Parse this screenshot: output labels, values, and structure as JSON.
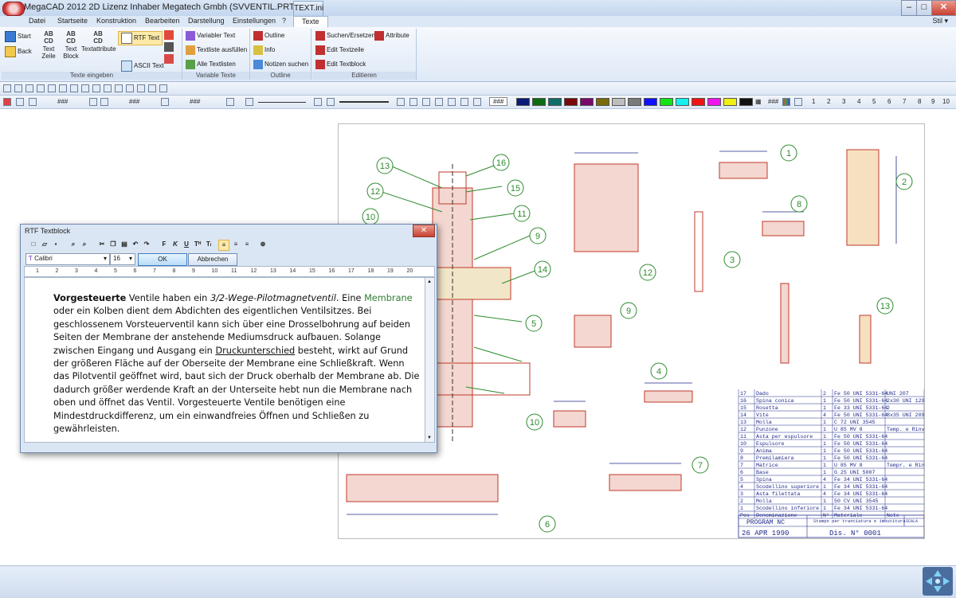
{
  "window": {
    "title": "MegaCAD 2012 2D  Lizenz Inhaber Megatech Gmbh (SVVENTIL.PRT)",
    "context_tab": "TEXT.ini",
    "min": "–",
    "max": "□",
    "close": "✕"
  },
  "menu": {
    "tabs": [
      "Datei",
      "Startseite",
      "Konstruktion",
      "Bearbeiten",
      "Darstellung",
      "Einstellungen",
      "?",
      "Texte"
    ],
    "stil": "Stil ▾"
  },
  "ribbon": {
    "groups": [
      {
        "title": "Texte eingeben",
        "items": [
          "Start",
          "Back",
          "Text Zeile",
          "Text Block",
          "Textattribute",
          "RTF Text",
          "ASCII Text"
        ]
      },
      {
        "title": "Variable Texte",
        "items": [
          "Variabler Text",
          "Textliste ausfüllen",
          "Alle Textlisten"
        ]
      },
      {
        "title": "Outline",
        "items": [
          "Outline",
          "Info",
          "Notizen suchen"
        ]
      },
      {
        "title": "Editieren",
        "items": [
          "Suchen/Ersetzen",
          "Attribute",
          "Edit Textzeile",
          "Edit Textblock"
        ]
      }
    ]
  },
  "toolbar2": {
    "fields": [
      "###",
      "###",
      "###",
      "###",
      "###"
    ],
    "zoom_values": [
      "1",
      "2",
      "3",
      "4",
      "5",
      "6",
      "7",
      "8",
      "9",
      "10"
    ],
    "colors": [
      "#0a1a78",
      "#0d6b12",
      "#0f6e6a",
      "#7a0a0a",
      "#7a0a6a",
      "#7a6a0a",
      "#bebebe",
      "#7a7a7a",
      "#1010ff",
      "#14e414",
      "#14f0f0",
      "#f01414",
      "#f014f0",
      "#f0f014",
      "#111111"
    ]
  },
  "dialog": {
    "title": "RTF Textblock",
    "close": "✕",
    "font": "Calibri",
    "size": "16",
    "ok": "OK",
    "cancel": "Abbrechen",
    "ruler_numbers": [
      "1",
      "2",
      "3",
      "4",
      "5",
      "6",
      "7",
      "8",
      "9",
      "10",
      "11",
      "12",
      "13",
      "14",
      "15",
      "16",
      "17",
      "18",
      "19",
      "20"
    ],
    "text": {
      "t1": "Vorgesteuerte",
      "t2": " Ventile haben ein ",
      "t3": "3/2-Wege-Pilotmagnetventil",
      "t4": ". Eine ",
      "t5": "Membrane",
      "t6": " oder ein Kolben dient dem Abdichten des eigentlichen Ventilsitzes. Bei geschlossenem Vorsteuerventil kann sich über eine Drosselbohrung auf beiden Seiten der Membrane der anstehende Mediumsdruck aufbauen. Solange zwischen Eingang und Ausgang ein ",
      "t7": "Druckunterschied",
      "t8": " besteht, wirkt auf Grund der größeren Fläche auf der Oberseite der Membrane eine Schließkraft. Wenn das Pilotventil geöffnet wird, baut sich der Druck oberhalb der Membrane ab. Die dadurch größer werdende Kraft an der Unterseite hebt nun die Membrane nach oben und öffnet das Ventil. Vorgesteuerte Ventile benötigen eine Mindestdruckdifferenz, um ein einwandfreies Öffnen und Schließen zu gewährleisten."
    }
  },
  "drawing": {
    "balloons": [
      "1",
      "2",
      "3",
      "4",
      "5",
      "6",
      "7",
      "8",
      "9",
      "10",
      "11",
      "12",
      "13",
      "14",
      "15",
      "16"
    ],
    "bom_rows": [
      [
        "17",
        "Dado",
        "2",
        "Fe 50 UNI 5331-64",
        "UNI 207"
      ],
      [
        "16",
        "Spina conica",
        "1",
        "Fe 50 UNI 5331-64",
        "2x30 UNI 129"
      ],
      [
        "15",
        "Rosetta",
        "1",
        "Fe 33 UNI 5331-64",
        "2"
      ],
      [
        "14",
        "Vite",
        "4",
        "Fe 50 UNI 5331-64",
        "8x35 UNI 2093"
      ],
      [
        "13",
        "Molla",
        "1",
        "C 72 UNI 3545",
        ""
      ],
      [
        "12",
        "Punzone",
        "1",
        "U 85 MV 8",
        "Temp. e Rinv."
      ],
      [
        "11",
        "Asta per espulsore",
        "1",
        "Fe 50 UNI 5331-64",
        ""
      ],
      [
        "10",
        "Espulsore",
        "1",
        "Fe 50 UNI 5331-64",
        ""
      ],
      [
        "9",
        "Anima",
        "1",
        "Fe 50 UNI 5331-64",
        ""
      ],
      [
        "8",
        "Premilamiera",
        "1",
        "Fe 50 UNI 5331-64",
        ""
      ],
      [
        "7",
        "Matrice",
        "1",
        "U 85 MV 8",
        "Tempr. e Rinv."
      ],
      [
        "6",
        "Base",
        "1",
        "G 25 UNI 5007",
        ""
      ],
      [
        "5",
        "Spina",
        "4",
        "Fe 34 UNI 5331-64",
        ""
      ],
      [
        "4",
        "Scodellino superiore",
        "1",
        "Fe 34 UNI 5331-64",
        ""
      ],
      [
        "3",
        "Asta filettata",
        "4",
        "Fe 34 UNI 5331-64",
        ""
      ],
      [
        "2",
        "Molla",
        "1",
        "50 CV UNI 3545",
        ""
      ],
      [
        "1",
        "Scodellino inferiore",
        "1",
        "Fe 34 UNI 5331-64",
        ""
      ]
    ],
    "bom_header": [
      "Pos",
      "Denominazione",
      "N°",
      "Materiale",
      "Note"
    ],
    "title_block": {
      "program": "PROGRAM NC",
      "subject": "Stampo per tranciatura e imbutitura",
      "scala": "SCALA",
      "date": "26 APR 1990",
      "drawing_no": "Dis. N° 0001"
    }
  }
}
